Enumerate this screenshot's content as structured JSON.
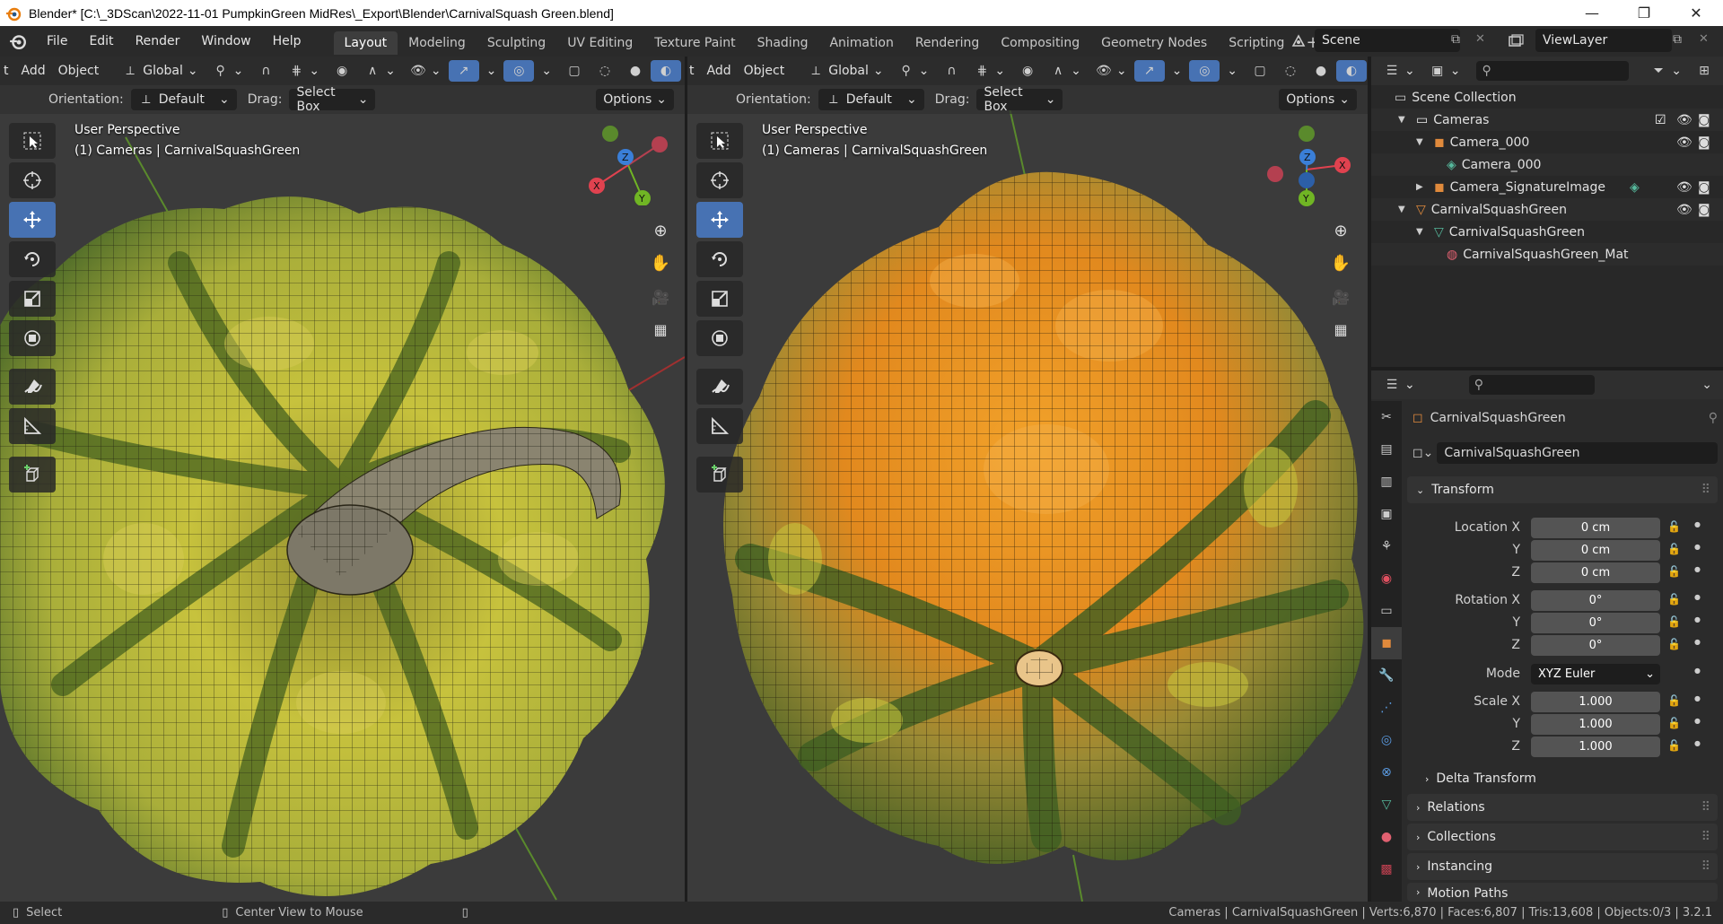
{
  "window": {
    "title": "Blender* [C:\\_3DScan\\2022-11-01 PumpkinGreen MidRes\\_Export\\Blender\\CarnivalSquash Green.blend]"
  },
  "menu": [
    "File",
    "Edit",
    "Render",
    "Window",
    "Help"
  ],
  "workspaces": [
    "Layout",
    "Modeling",
    "Sculpting",
    "UV Editing",
    "Texture Paint",
    "Shading",
    "Animation",
    "Rendering",
    "Compositing",
    "Geometry Nodes",
    "Scripting"
  ],
  "active_workspace": "Layout",
  "scene": "Scene",
  "view_layer": "ViewLayer",
  "viewport_left": {
    "header": {
      "add": "Add",
      "object": "Object",
      "transform": "Global"
    },
    "orientation_label": "Orientation:",
    "orientation_value": "Default",
    "drag_label": "Drag:",
    "drag_value": "Select Box",
    "options": "Options",
    "view_name": "User Perspective",
    "view_context": "(1) Cameras | CarnivalSquashGreen",
    "clip_letter": "t"
  },
  "viewport_right": {
    "header": {
      "add": "Add",
      "object": "Object",
      "transform": "Global"
    },
    "orientation_label": "Orientation:",
    "orientation_value": "Default",
    "drag_label": "Drag:",
    "drag_value": "Select Box",
    "options": "Options",
    "view_name": "User Perspective",
    "view_context": "(1) Cameras | CarnivalSquashGreen",
    "clip_letter": "t"
  },
  "gizmo_labels": {
    "x": "X",
    "y": "Y",
    "z": "Z"
  },
  "outliner": {
    "root": "Scene Collection",
    "items": [
      {
        "label": "Cameras",
        "icon": "collection-icon"
      },
      {
        "label": "Camera_000",
        "icon": "camera-object-icon"
      },
      {
        "label": "Camera_000",
        "icon": "camera-data-icon"
      },
      {
        "label": "Camera_SignatureImage",
        "icon": "camera-object-icon"
      },
      {
        "label": "CarnivalSquashGreen",
        "icon": "collection-icon"
      },
      {
        "label": "CarnivalSquashGreen",
        "icon": "mesh-icon"
      },
      {
        "label": "CarnivalSquashGreen_Mat",
        "icon": "material-icon"
      }
    ]
  },
  "properties": {
    "object_name": "CarnivalSquashGreen",
    "datablock_name": "CarnivalSquashGreen",
    "transform_title": "Transform",
    "location_label": "Location X",
    "rotation_label": "Rotation X",
    "scale_label": "Scale X",
    "mode_label": "Mode",
    "y_label": "Y",
    "z_label": "Z",
    "location": [
      "0 cm",
      "0 cm",
      "0 cm"
    ],
    "rotation": [
      "0°",
      "0°",
      "0°"
    ],
    "rotation_mode": "XYZ Euler",
    "scale": [
      "1.000",
      "1.000",
      "1.000"
    ],
    "delta_transform": "Delta Transform",
    "panels": [
      "Relations",
      "Collections",
      "Instancing",
      "Motion Paths"
    ]
  },
  "statusbar": {
    "select": "Select",
    "center_view": "Center View to Mouse",
    "info": "Cameras | CarnivalSquashGreen | Verts:6,870 | Faces:6,807 | Tris:13,608 | Objects:0/3 | 3.2.1"
  },
  "colors": {
    "accent": "#4772b3",
    "axis_x": "#e0424f",
    "axis_y": "#70b524",
    "axis_z": "#3a7fd8",
    "squash_yellow": "#c9c43a",
    "squash_green": "#4e6a2a",
    "squash_orange": "#e58a1c"
  }
}
